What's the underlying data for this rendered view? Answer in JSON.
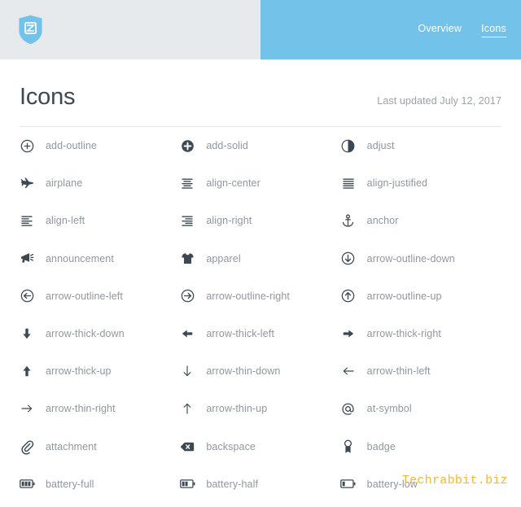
{
  "header": {
    "logo_name": "shield-z-logo",
    "bg_left": "#e7eaec",
    "bg_right": "#72c2e9",
    "nav": [
      {
        "label": "Overview",
        "active": false
      },
      {
        "label": "Icons",
        "active": true
      }
    ]
  },
  "page": {
    "title": "Icons",
    "last_updated": "Last updated July 12, 2017",
    "accent_color": "#72c2e9",
    "icon_color": "#3d4852",
    "label_color": "#9097a0"
  },
  "icons": [
    {
      "name": "add-outline",
      "label": "add-outline"
    },
    {
      "name": "add-solid",
      "label": "add-solid"
    },
    {
      "name": "adjust",
      "label": "adjust"
    },
    {
      "name": "airplane",
      "label": "airplane"
    },
    {
      "name": "align-center",
      "label": "align-center"
    },
    {
      "name": "align-justified",
      "label": "align-justified"
    },
    {
      "name": "align-left",
      "label": "align-left"
    },
    {
      "name": "align-right",
      "label": "align-right"
    },
    {
      "name": "anchor",
      "label": "anchor"
    },
    {
      "name": "announcement",
      "label": "announcement"
    },
    {
      "name": "apparel",
      "label": "apparel"
    },
    {
      "name": "arrow-outline-down",
      "label": "arrow-outline-down"
    },
    {
      "name": "arrow-outline-left",
      "label": "arrow-outline-left"
    },
    {
      "name": "arrow-outline-right",
      "label": "arrow-outline-right"
    },
    {
      "name": "arrow-outline-up",
      "label": "arrow-outline-up"
    },
    {
      "name": "arrow-thick-down",
      "label": "arrow-thick-down"
    },
    {
      "name": "arrow-thick-left",
      "label": "arrow-thick-left"
    },
    {
      "name": "arrow-thick-right",
      "label": "arrow-thick-right"
    },
    {
      "name": "arrow-thick-up",
      "label": "arrow-thick-up"
    },
    {
      "name": "arrow-thin-down",
      "label": "arrow-thin-down"
    },
    {
      "name": "arrow-thin-left",
      "label": "arrow-thin-left"
    },
    {
      "name": "arrow-thin-right",
      "label": "arrow-thin-right"
    },
    {
      "name": "arrow-thin-up",
      "label": "arrow-thin-up"
    },
    {
      "name": "at-symbol",
      "label": "at-symbol"
    },
    {
      "name": "attachment",
      "label": "attachment"
    },
    {
      "name": "backspace",
      "label": "backspace"
    },
    {
      "name": "badge",
      "label": "badge"
    },
    {
      "name": "battery-full",
      "label": "battery-full"
    },
    {
      "name": "battery-half",
      "label": "battery-half"
    },
    {
      "name": "battery-low",
      "label": "battery-low"
    }
  ],
  "watermark": {
    "text": "Techrabbit.biz",
    "color": "#f5b731"
  }
}
